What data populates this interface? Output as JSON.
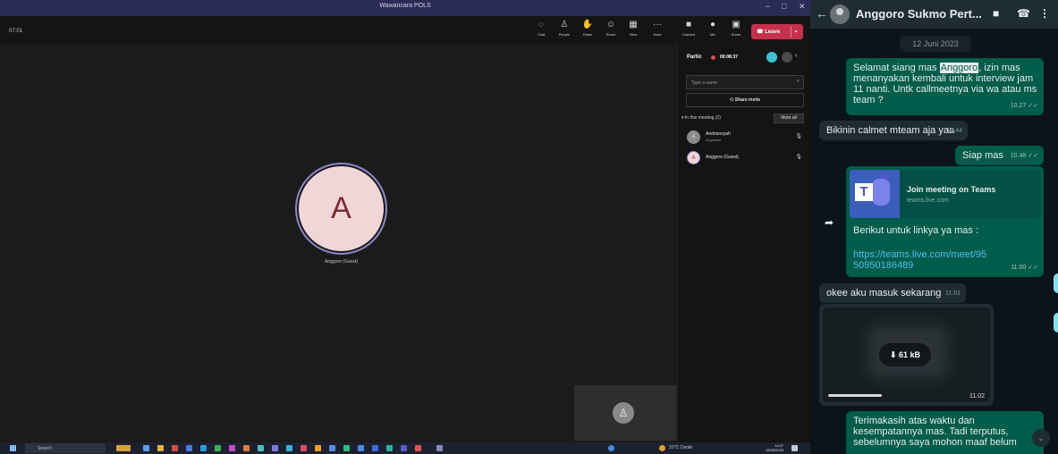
{
  "teams": {
    "window_title": "Wawancara POLS",
    "timer": "07:01",
    "toolbar": [
      {
        "icon": "chat-icon",
        "label": "Chat",
        "glyph": "◌"
      },
      {
        "icon": "people-icon",
        "label": "People",
        "glyph": "♙"
      },
      {
        "icon": "raise-hand-icon",
        "label": "Raise",
        "glyph": "✋"
      },
      {
        "icon": "react-icon",
        "label": "React",
        "glyph": "☺"
      },
      {
        "icon": "view-icon",
        "label": "View",
        "glyph": "▦"
      },
      {
        "icon": "more-icon",
        "label": "More",
        "glyph": "···"
      },
      {
        "icon": "camera-icon",
        "label": "Camera",
        "glyph": "■"
      },
      {
        "icon": "mic-icon",
        "label": "Mic",
        "glyph": "●"
      },
      {
        "icon": "share-icon",
        "label": "Share",
        "glyph": "▣"
      }
    ],
    "leave_label": "Leave",
    "stage": {
      "avatar_letter": "A",
      "participant_name": "Anggoro (Guest)"
    },
    "panel": {
      "title": "Partic",
      "rec_time": "00:08:37",
      "search_placeholder": "Type a name",
      "share_label": "Share invite",
      "in_meeting_label": "In this meeting (2)",
      "mute_all_label": "Mute all",
      "participants": [
        {
          "initial": "",
          "name": "Andriansyah",
          "role": "Organizer",
          "color": "#8a8a8a"
        },
        {
          "initial": "A",
          "name": "Anggoro (Guest)",
          "role": "",
          "color": "#f1d6d8"
        }
      ]
    },
    "taskbar": {
      "search_label": "Search",
      "tray_text": "31°C Cerah",
      "time": "11:07",
      "date": "12/06/2023"
    }
  },
  "whatsapp": {
    "contact_name": "Anggoro Sukmo Pert...",
    "date_chip": "12 Juni 2023",
    "messages": [
      {
        "pre": "Selamat siang mas ",
        "highlight": "Anggoro",
        "post": ", izin mas menanyakan kembali untuk interview jam 11 nanti. Untk callmeetnya via wa atau ms team ?",
        "time": "10.27"
      },
      {
        "text": "Bikinin calmet mteam aja yaa",
        "time": "10.44"
      },
      {
        "text": "Siap mas",
        "time": "10.48"
      },
      {
        "preview_title": "Join meeting on Teams",
        "preview_domain": "teams.live.com",
        "text": "Berikut untuk linkya ya mas :",
        "link": "https://teams.live.com/meet/9550950186489",
        "time": "11.00"
      },
      {
        "text": "okee aku masuk sekarang",
        "time": "11.01"
      },
      {
        "video_size": "61 kB",
        "time": "11.02"
      },
      {
        "text": "Terimakasih atas waktu dan kesempatannya mas. Tadi terputus, sebelumnya saya mohon maaf belum"
      }
    ]
  }
}
